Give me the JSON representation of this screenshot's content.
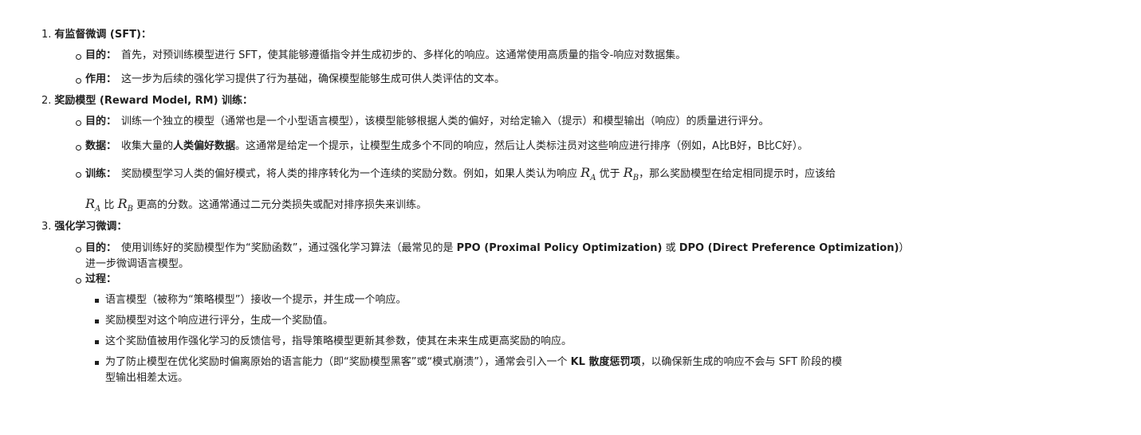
{
  "s1": {
    "num": "1.",
    "title": "有监督微调 (SFT)：",
    "purpose_label": "目的：",
    "purpose_text": "首先，对预训练模型进行 SFT，使其能够遵循指令并生成初步的、多样化的响应。这通常使用高质量的指令-响应对数据集。",
    "effect_label": "作用：",
    "effect_text": "这一步为后续的强化学习提供了行为基础，确保模型能够生成可供人类评估的文本。"
  },
  "s2": {
    "num": "2.",
    "title": "奖励模型 (Reward Model, RM) 训练：",
    "purpose_label": "目的：",
    "purpose_text": "训练一个独立的模型（通常也是一个小型语言模型），该模型能够根据人类的偏好，对给定输入（提示）和模型输出（响应）的质量进行评分。",
    "data_label": "数据：",
    "data_pre": "收集大量的",
    "data_bold": "人类偏好数据",
    "data_post": "。这通常是给定一个提示，让模型生成多个不同的响应，然后让人类标注员对这些响应进行排序（例如，A比B好，B比C好）。",
    "train_label": "训练：",
    "train_text_1": "奖励模型学习人类的偏好模式，将人类的排序转化为一个连续的奖励分数。例如，如果人类认为响应",
    "train_text_2": "优于",
    "train_text_3": "，那么奖励模型在给定相同提示时，应该给",
    "train_text_4": "比",
    "train_text_5": "更高的分数。这通常通过二元分类损失或配对排序损失来训练。",
    "math_R": "R",
    "math_A": "A",
    "math_B": "B"
  },
  "s3": {
    "num": "3.",
    "title": "强化学习微调：",
    "purpose_label": "目的：",
    "purpose_pre": "使用训练好的奖励模型作为“奖励函数”，通过强化学习算法（最常见的是 ",
    "ppo": "PPO (Proximal Policy Optimization)",
    "or": " 或 ",
    "dpo": "DPO (Direct Preference Optimization)",
    "purpose_post": "）",
    "purpose_line2": "进一步微调语言模型。",
    "process_label": "过程：",
    "steps": [
      "语言模型（被称为“策略模型”）接收一个提示，并生成一个响应。",
      "奖励模型对这个响应进行评分，生成一个奖励值。",
      "这个奖励值被用作强化学习的反馈信号，指导策略模型更新其参数，使其在未来生成更高奖励的响应。"
    ],
    "step4_pre": "为了防止模型在优化奖励时偏离原始的语言能力（即“奖励模型黑客”或“模式崩溃”），通常会引入一个 ",
    "step4_bold": "KL 散度惩罚项",
    "step4_post": "，以确保新生成的响应不会与 SFT 阶段的模",
    "step4_line2": "型输出相差太远。"
  }
}
